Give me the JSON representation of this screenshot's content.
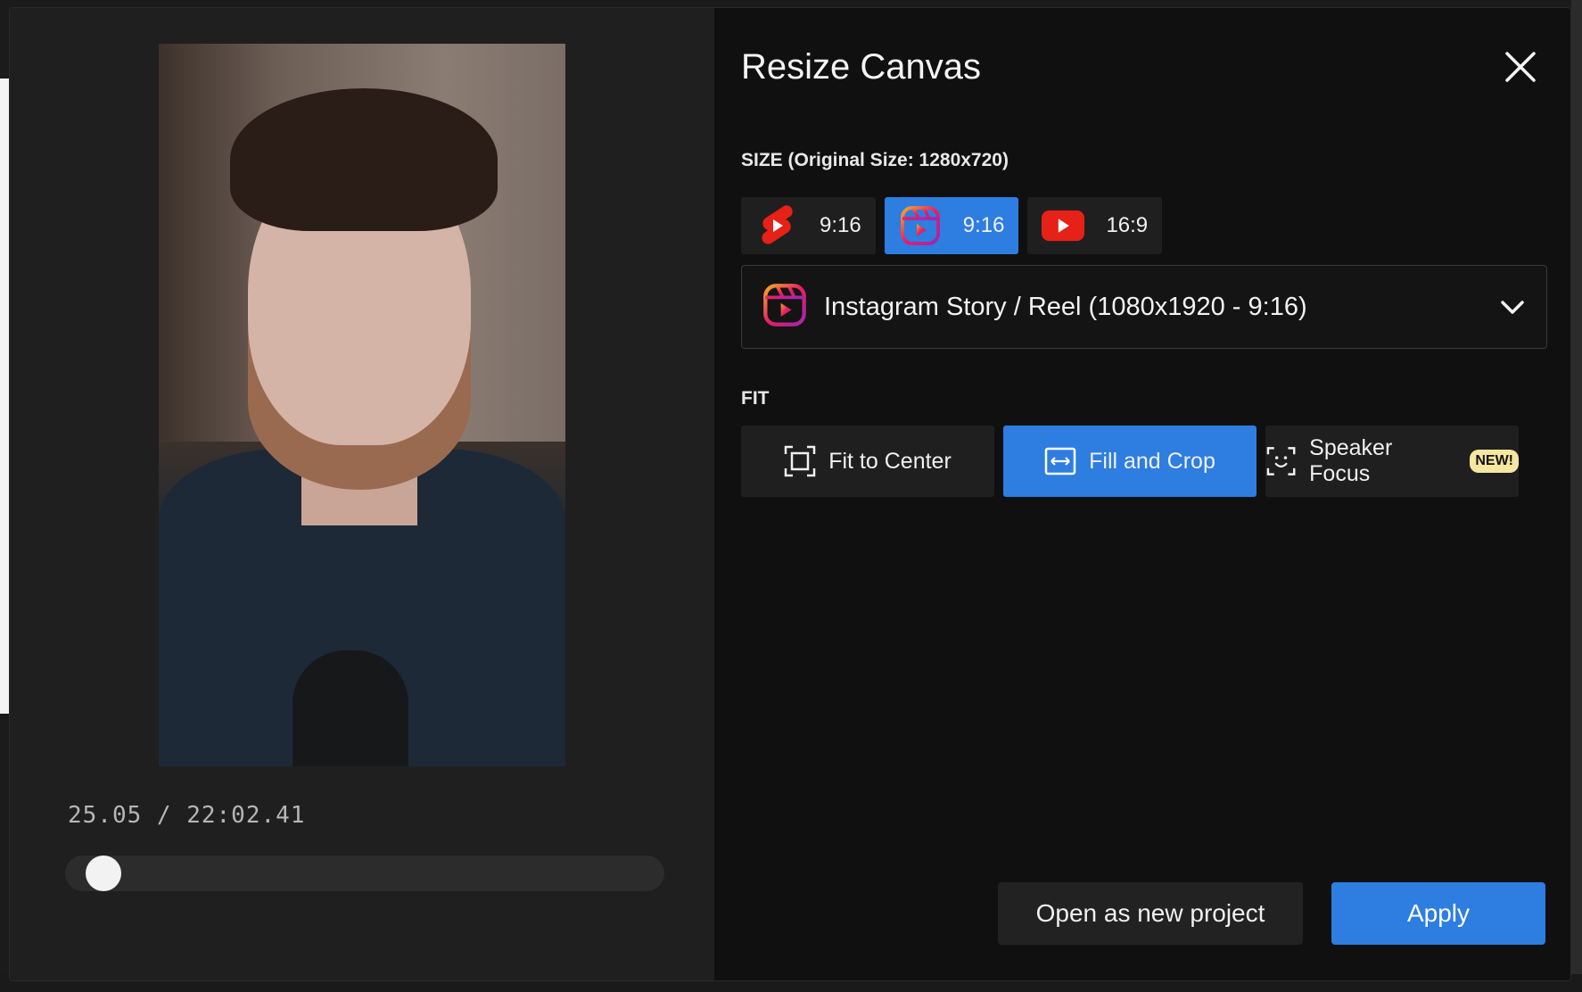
{
  "dialog": {
    "title": "Resize Canvas",
    "close_icon": "close-icon"
  },
  "preview": {
    "timecode": "25.05 / 22:02.41",
    "progress_fraction": 0.02
  },
  "size": {
    "label": "SIZE (Original Size: 1280x720)",
    "presets": [
      {
        "icon": "youtube-shorts-icon",
        "label": "9:16",
        "active": false
      },
      {
        "icon": "instagram-reels-icon",
        "label": "9:16",
        "active": true
      },
      {
        "icon": "youtube-icon",
        "label": "16:9",
        "active": false
      }
    ],
    "selected_option": "Instagram Story / Reel (1080x1920 - 9:16)"
  },
  "fit": {
    "label": "FIT",
    "options": [
      {
        "icon": "fit-center-icon",
        "label": "Fit to Center",
        "active": false
      },
      {
        "icon": "fill-crop-icon",
        "label": "Fill and Crop",
        "active": true
      },
      {
        "icon": "speaker-focus-icon",
        "label": "Speaker Focus",
        "badge": "NEW!",
        "active": false
      }
    ]
  },
  "actions": {
    "secondary": "Open as new project",
    "primary": "Apply"
  },
  "colors": {
    "accent": "#2e7de1",
    "panel": "#101010",
    "badge": "#f5e7a0"
  }
}
